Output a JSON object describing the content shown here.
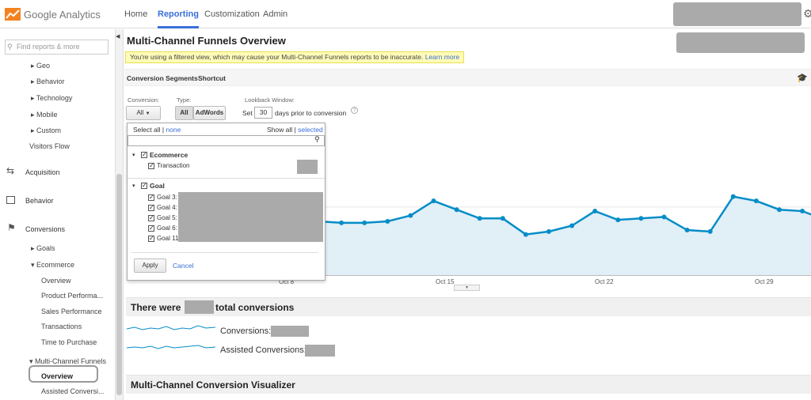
{
  "app": {
    "name": "Google Analytics"
  },
  "topnav": [
    {
      "label": "Home",
      "active": false
    },
    {
      "label": "Reporting",
      "active": true
    },
    {
      "label": "Customization",
      "active": false
    },
    {
      "label": "Admin",
      "active": false
    }
  ],
  "sidebar": {
    "search_placeholder": "Find reports & more",
    "items": [
      {
        "label": "▸ Geo"
      },
      {
        "label": "▸ Behavior"
      },
      {
        "label": "▸ Technology"
      },
      {
        "label": "▸ Mobile"
      },
      {
        "label": "▸ Custom"
      },
      {
        "label": "Visitors Flow"
      }
    ],
    "sections": [
      {
        "label": "Acquisition",
        "icon": "arrows-icon"
      },
      {
        "label": "Behavior",
        "icon": "page-icon"
      },
      {
        "label": "Conversions",
        "icon": "flag-icon"
      }
    ],
    "conversions": {
      "goals": "▸ Goals",
      "ecommerce": "▾ Ecommerce",
      "ecommerce_items": [
        "Overview",
        "Product Performa...",
        "Sales Performance",
        "Transactions",
        "Time to Purchase"
      ],
      "mcf": "▾ Multi-Channel Funnels",
      "mcf_items": [
        "Overview",
        "Assisted Conversi..."
      ]
    }
  },
  "page": {
    "title": "Multi-Channel Funnels Overview",
    "warning": "You're using a filtered view, which may cause your Multi-Channel Funnels reports to be inaccurate.",
    "warning_link": "Learn more",
    "tabs": [
      "Conversion Segments",
      "Shortcut"
    ]
  },
  "controls": {
    "conversion_label": "Conversion:",
    "conversion_value": "All",
    "type_label": "Type:",
    "type_all": "All",
    "type_adwords": "AdWords",
    "lookback_label": "Lookback Window:",
    "set_label": "Set",
    "days_value": "30",
    "days_label": "days prior to conversion",
    "help_icon": "?"
  },
  "dropdown": {
    "select_all": "Select all",
    "separator": "|",
    "none": "none",
    "show_all": "Show all",
    "selected": "selected",
    "groups": [
      {
        "name": "Ecommerce",
        "items": [
          "Transaction"
        ]
      },
      {
        "name": "Goal",
        "items": [
          "Goal 3:",
          "Goal 4:",
          "Goal 5:",
          "Goal 6:",
          "Goal 11"
        ]
      }
    ],
    "apply": "Apply",
    "cancel": "Cancel"
  },
  "chart_data": {
    "type": "area",
    "x_ticks": [
      "Oct 8",
      "Oct 15",
      "Oct 22",
      "Oct 29"
    ],
    "series": [
      {
        "values": [
          45,
          44,
          44,
          45,
          49,
          59,
          53,
          47,
          47,
          36,
          38,
          42,
          52,
          46,
          47,
          48,
          39,
          38,
          62,
          59,
          53,
          52,
          46
        ]
      }
    ],
    "color": "#058dc7",
    "fill": "#e1eff7",
    "grid": true
  },
  "summary": {
    "prefix": "There were",
    "suffix": "total conversions",
    "conversions_label": "Conversions:",
    "assisted_label": "Assisted Conversions:"
  },
  "visualizer": {
    "title": "Multi-Channel Conversion Visualizer"
  }
}
